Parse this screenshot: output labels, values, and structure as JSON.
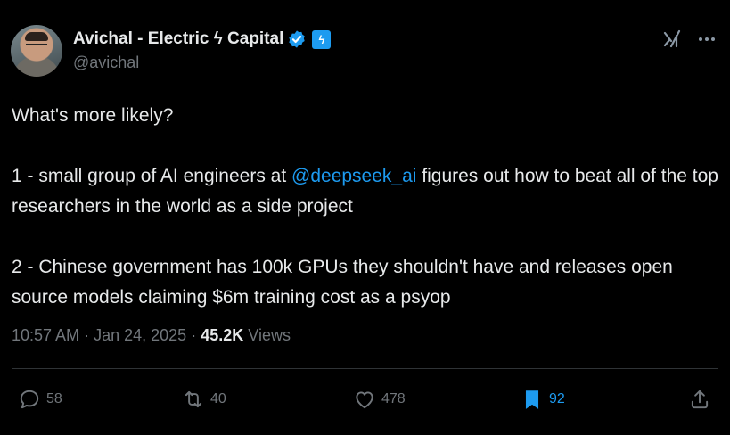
{
  "author": {
    "display_name": "Avichal - Electric ϟ Capital",
    "handle": "@avichal",
    "affiliate_badge": "ϟ"
  },
  "tweet": {
    "line_intro": "What's more likely?",
    "option1_before": "1 - small group of AI engineers at ",
    "option1_mention": "@deepseek_ai",
    "option1_after": " figures out how to beat all of the top researchers in the world as a side project",
    "option2": "2 - Chinese government has 100k GPUs they shouldn't have and releases open source models claiming $6m training cost as a psyop"
  },
  "meta": {
    "time": "10:57 AM",
    "sep1": "·",
    "date": "Jan 24, 2025",
    "sep2": "·",
    "views_count": "45.2K",
    "views_label": "Views"
  },
  "actions": {
    "reply_count": "58",
    "retweet_count": "40",
    "like_count": "478",
    "bookmark_count": "92"
  },
  "icons": {
    "verified": "verified-badge-icon",
    "grok": "grok-icon",
    "more": "more-icon",
    "reply": "reply-icon",
    "retweet": "retweet-icon",
    "like": "heart-icon",
    "bookmark": "bookmark-icon",
    "share": "share-icon"
  },
  "colors": {
    "background": "#000000",
    "text": "#e7e9ea",
    "secondary": "#71767b",
    "accent": "#1d9bf0"
  }
}
